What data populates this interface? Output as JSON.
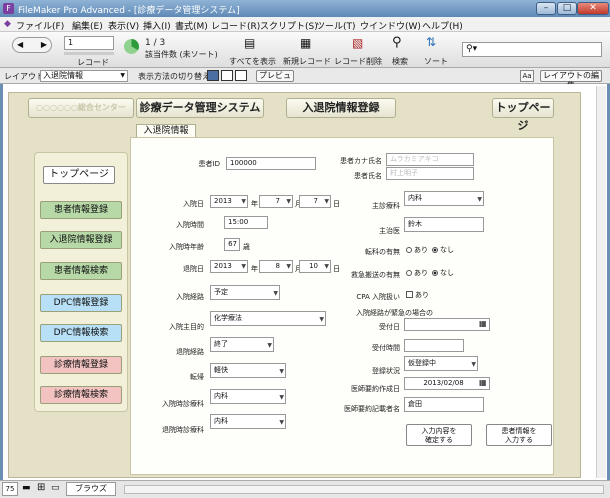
{
  "window": {
    "title": "FileMaker Pro Advanced - [診療データ管理システム]",
    "minimize": "–",
    "maximize": "□",
    "close": "✕"
  },
  "menu": [
    "ファイル(F)",
    "編集(E)",
    "表示(V)",
    "挿入(I)",
    "書式(M)",
    "レコード(R)",
    "スクリプト(S)",
    "ツール(T)",
    "ウインドウ(W)",
    "ヘルプ(H)"
  ],
  "toolbar": {
    "record_number": "1",
    "record_label": "レコード",
    "found": "1 / 3",
    "found_detail": "該当件数 (未ソート)",
    "show_all": "すべてを表示",
    "new_record": "新規レコード",
    "delete_record": "レコード削除",
    "find": "検索",
    "sort": "ソート",
    "search_placeholder": ""
  },
  "layoutbar": {
    "layout_label": "レイアウト:",
    "layout_value": "入退院情報",
    "view_label": "表示方法の切り替え:",
    "preview": "プレビュー",
    "aa": "Aa",
    "edit_layout": "レイアウトの編集"
  },
  "header": {
    "org": "○○○○○○総合センター",
    "system": "診療データ管理システム",
    "section": "入退院情報登録",
    "top": "トップページ"
  },
  "tab": "入退院情報",
  "sidebar": {
    "top": "トップページ",
    "items": [
      "患者情報登録",
      "入退院情報登録",
      "患者情報検索",
      "DPC情報登録",
      "DPC情報検索",
      "診療情報登録",
      "診療情報検索"
    ]
  },
  "form": {
    "patient_id_label": "患者ID",
    "patient_id": "100000",
    "kana_label": "患者カナ氏名",
    "kana": "ムラカミアキコ",
    "name_label": "患者氏名",
    "name": "村上明子",
    "admit_date_label": "入院日",
    "admit_y": "2013",
    "admit_m": "7",
    "admit_d": "7",
    "year": "年",
    "month": "月",
    "day": "日",
    "admit_time_label": "入院時間",
    "admit_time": "15:00",
    "admit_age_label": "入院時年齢",
    "admit_age": "67",
    "age_unit": "歳",
    "discharge_label": "退院日",
    "dis_y": "2013",
    "dis_m": "8",
    "dis_d": "10",
    "route_label": "入院経路",
    "route": "予定",
    "purpose_label": "入院主目的",
    "purpose": "化学療法",
    "dis_route_label": "退院経路",
    "dis_route": "終了",
    "outcome_label": "転帰",
    "outcome": "軽快",
    "admit_dept_label": "入院時診療科",
    "admit_dept": "内科",
    "dis_dept_label": "退院時診療科",
    "dis_dept": "内科",
    "main_dept_label": "主診療科",
    "main_dept": "内科",
    "doctor_label": "主治医",
    "doctor": "鈴木",
    "transfer_label": "転科の有無",
    "yes": "あり",
    "no": "なし",
    "ambulance_label": "救急搬送の有無",
    "cpa_label": "CPA 入院扱い",
    "cpa": "あり",
    "emergency_label": "入院経路が緊急の場合の",
    "reception_date_label": "受付日",
    "reception_date": "",
    "reception_time_label": "受付時間",
    "reception_time": "",
    "reg_status_label": "登録状況",
    "reg_status": "仮登録中",
    "summary_date_label": "医師要約作成日",
    "summary_date": "2013/02/08",
    "summary_author_label": "医師要約記載者名",
    "summary_author": "倉田",
    "confirm_btn_1": "入力内容を",
    "confirm_btn_2": "確定する",
    "patient_btn_1": "患者情報を",
    "patient_btn_2": "入力する"
  },
  "status": {
    "zoom": "75",
    "mode": "ブラウズ"
  }
}
